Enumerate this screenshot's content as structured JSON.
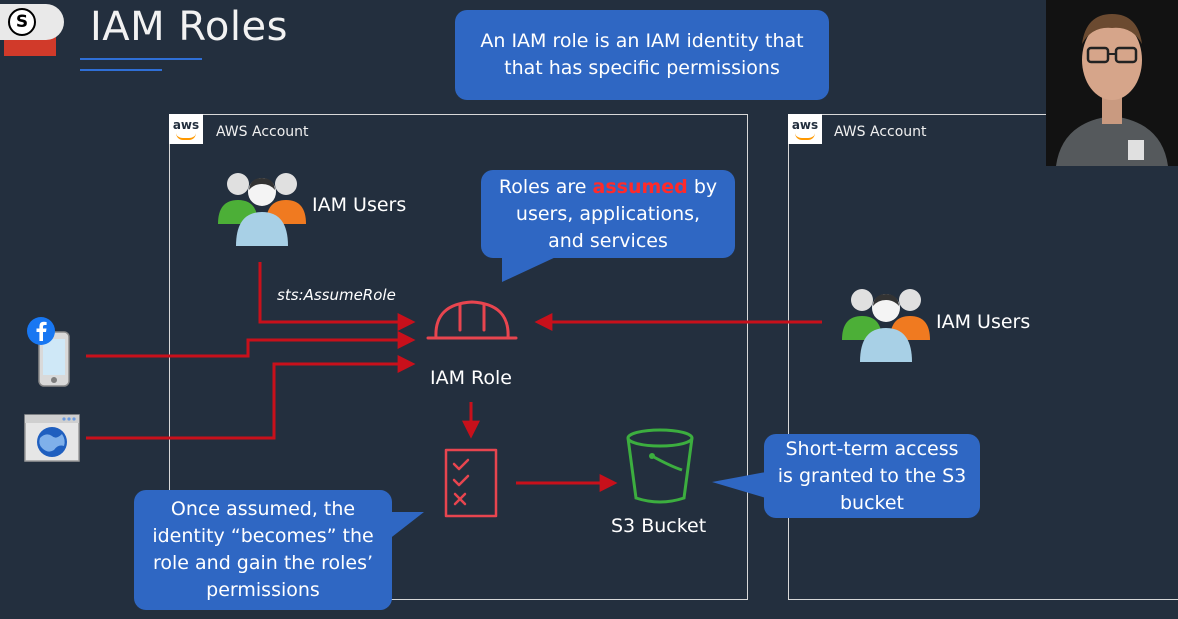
{
  "slide": {
    "title": "IAM Roles",
    "logo_letter": "S"
  },
  "accounts": [
    {
      "label": "AWS Account",
      "icon": "aws"
    },
    {
      "label": "AWS Account",
      "icon": "aws"
    }
  ],
  "callouts": {
    "top": "An IAM role is an IAM identity that that has specific permissions",
    "assumed_prefix": "Roles are ",
    "assumed_word": "assumed",
    "assumed_suffix": " by users, applications, and services",
    "becomes": "Once assumed, the identity “becomes” the role and gain the roles’ permissions",
    "short_term": "Short-term access is granted to the S3 bucket"
  },
  "labels": {
    "iam_users_left": "IAM Users",
    "iam_users_right": "IAM Users",
    "sts_assume_role": "sts:AssumeRole",
    "iam_role": "IAM Role",
    "s3_bucket": "S3 Bucket"
  },
  "colors": {
    "background": "#232f3e",
    "arrow_red": "#c8101b",
    "role_icon": "#e8454f",
    "callout_blue": "#2f67c3",
    "bucket_green": "#3cae3f",
    "aws_orange": "#ff9900"
  },
  "icons": [
    "users-group-icon",
    "hard-hat-icon",
    "checklist-icon",
    "s3-bucket-icon",
    "facebook-icon",
    "mobile-phone-icon",
    "browser-globe-icon"
  ]
}
